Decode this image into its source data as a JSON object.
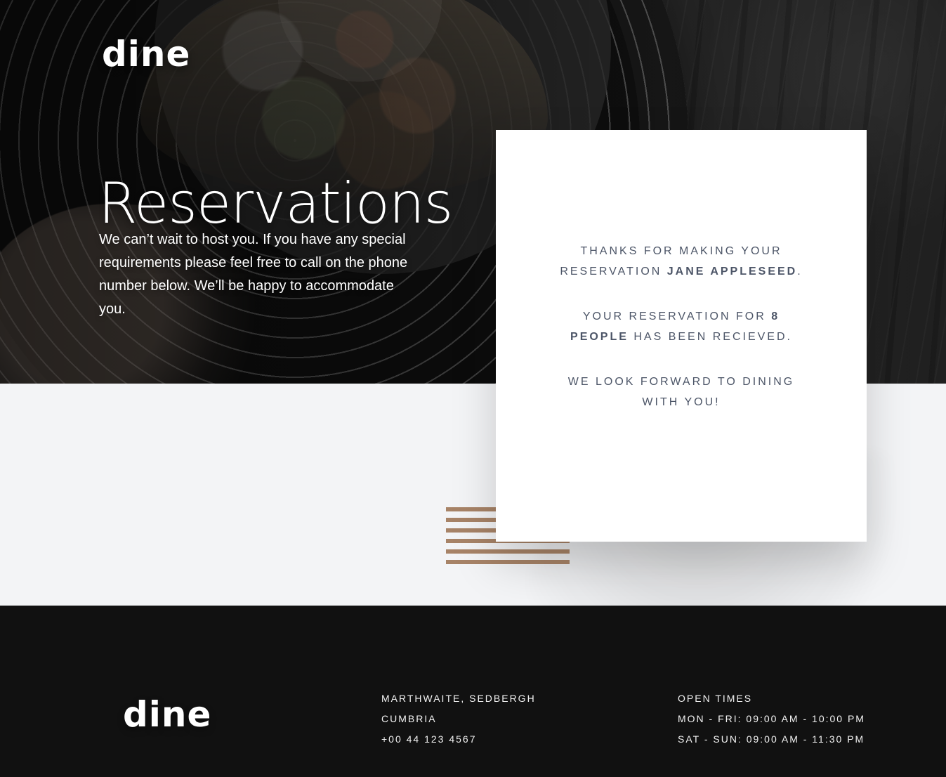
{
  "brand": {
    "name": "dine"
  },
  "hero": {
    "title": "Reservations",
    "text": "We can’t wait to host you. If you have any special requirements please feel free to call on the phone number below. We’ll be happy to accommodate you."
  },
  "confirmation": {
    "thanks_prefix": "THANKS FOR MAKING YOUR RESERVATION ",
    "name": "JANE APPLESEED",
    "thanks_suffix": ".",
    "reservation_prefix": "YOUR RESERVATION FOR ",
    "people": "8 PEOPLE",
    "reservation_suffix": " HAS BEEN RECIEVED.",
    "closing": "WE LOOK FORWARD TO DINING WITH YOU!"
  },
  "footer": {
    "address": {
      "line1": "MARTHWAITE, SEDBERGH",
      "line2": "CUMBRIA",
      "phone": "+00 44 123 4567"
    },
    "hours": {
      "title": "OPEN TIMES",
      "line1": "MON - FRI: 09:00 AM - 10:00 PM",
      "line2": "SAT - SUN: 09:00 AM - 11:30 PM"
    }
  },
  "theme": {
    "card_text": "#4c5567",
    "accent_lines": "#a27c5f",
    "page_bg": "#f3f4f6",
    "footer_bg": "#111111"
  }
}
